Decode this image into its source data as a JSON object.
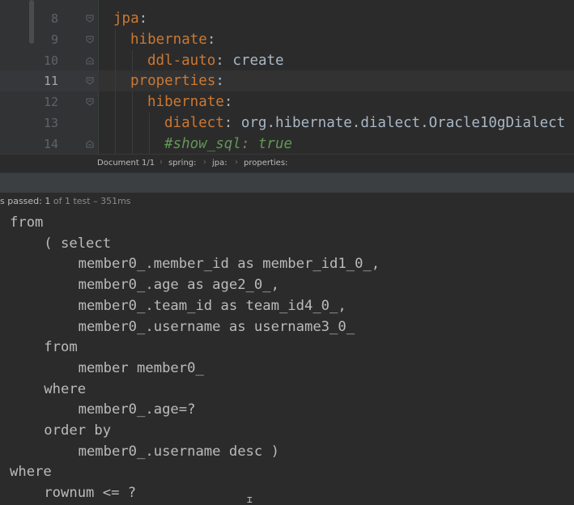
{
  "editor": {
    "lines": [
      {
        "num": "8",
        "indent": 0,
        "key": "jpa",
        "sep": ":",
        "value": "",
        "comment": "",
        "fold": "open"
      },
      {
        "num": "9",
        "indent": 1,
        "key": "hibernate",
        "sep": ":",
        "value": "",
        "comment": "",
        "fold": "open"
      },
      {
        "num": "10",
        "indent": 2,
        "key": "ddl-auto",
        "sep": ": ",
        "value": "create",
        "comment": "",
        "fold": "close"
      },
      {
        "num": "11",
        "indent": 1,
        "key": "properties",
        "sep": ":",
        "value": "",
        "comment": "",
        "fold": "open"
      },
      {
        "num": "12",
        "indent": 2,
        "key": "hibernate",
        "sep": ":",
        "value": "",
        "comment": "",
        "fold": "open"
      },
      {
        "num": "13",
        "indent": 3,
        "key": "dialect",
        "sep": ": ",
        "value": "org.hibernate.dialect.Oracle10gDialect",
        "comment": "",
        "fold": ""
      },
      {
        "num": "14",
        "indent": 3,
        "key": "",
        "sep": "",
        "value": "",
        "comment": "#show_sql: true",
        "fold": "close"
      }
    ]
  },
  "breadcrumb": {
    "items": [
      "Document 1/1",
      "spring:",
      "jpa:",
      "properties:"
    ]
  },
  "status": {
    "prefix": "s passed: ",
    "count": "1",
    "rest": " of 1 test – 351ms"
  },
  "console": {
    "lines": [
      {
        "indent": 0,
        "text": "from"
      },
      {
        "indent": 1,
        "text": "( select"
      },
      {
        "indent": 2,
        "text": "member0_.member_id as member_id1_0_,"
      },
      {
        "indent": 2,
        "text": "member0_.age as age2_0_,"
      },
      {
        "indent": 2,
        "text": "member0_.team_id as team_id4_0_,"
      },
      {
        "indent": 2,
        "text": "member0_.username as username3_0_"
      },
      {
        "indent": 1,
        "text": "from"
      },
      {
        "indent": 2,
        "text": "member member0_"
      },
      {
        "indent": 1,
        "text": "where"
      },
      {
        "indent": 2,
        "text": "member0_.age=?"
      },
      {
        "indent": 1,
        "text": "order by"
      },
      {
        "indent": 2,
        "text": "member0_.username desc )"
      },
      {
        "indent": 0,
        "text": "where"
      },
      {
        "indent": 1,
        "text": "rownum <= ?"
      }
    ]
  },
  "colors": {
    "key": "#cc7832",
    "text": "#a9b7c6",
    "comment": "#629755",
    "line_number": "#606366",
    "console_text": "#bbbbbb",
    "background": "#2b2b2b"
  }
}
